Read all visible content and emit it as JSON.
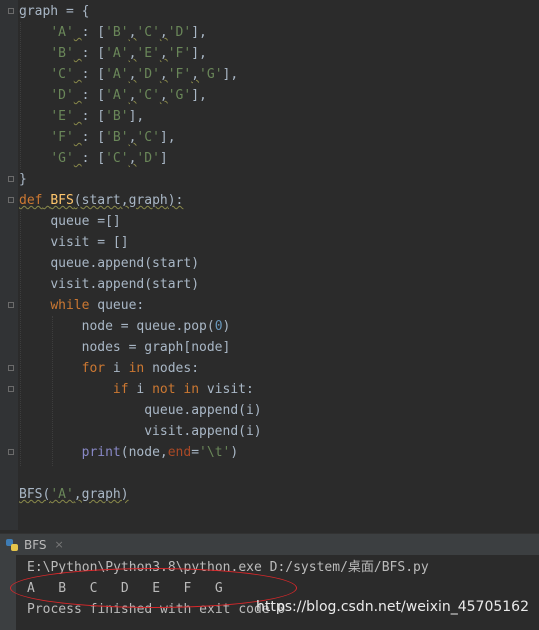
{
  "editor": {
    "line_1": "graph = {",
    "graph_lines": [
      {
        "key": "'A'",
        "items": [
          "'B'",
          "'C'",
          "'D'"
        ]
      },
      {
        "key": "'B'",
        "items": [
          "'A'",
          "'E'",
          "'F'"
        ]
      },
      {
        "key": "'C'",
        "items": [
          "'A'",
          "'D'",
          "'F'",
          "'G'"
        ]
      },
      {
        "key": "'D'",
        "items": [
          "'A'",
          "'C'",
          "'G'"
        ]
      },
      {
        "key": "'E'",
        "items": [
          "'B'"
        ]
      },
      {
        "key": "'F'",
        "items": [
          "'B'",
          "'C'"
        ]
      },
      {
        "key": "'G'",
        "items": [
          "'C'",
          "'D'"
        ]
      }
    ],
    "close_brace": "}",
    "def_kw": "def",
    "func_name": "BFS",
    "param_start": "start",
    "param_graph": "graph",
    "queue_init": "queue =[]",
    "visit_init": "visit = []",
    "queue_append": "queue.append(start)",
    "visit_append": "visit.append(start)",
    "while_kw": "while",
    "while_cond": " queue:",
    "node_pop_pre": "node = queue.pop(",
    "node_pop_num": "0",
    "node_pop_post": ")",
    "nodes_line": "nodes = graph[node]",
    "for_kw": "for",
    "for_var": " i ",
    "in_kw": "in",
    "for_iter": " nodes:",
    "if_kw": "if",
    "if_var": " i ",
    "not_kw": "not",
    "in_kw2": "in",
    "if_rest": " visit:",
    "qa_i": "queue.append(i)",
    "va_i": "visit.append(i)",
    "print_fn": "print",
    "print_args": "(node,",
    "end_kw": "end",
    "print_eq": "=",
    "print_str": "'\\t'",
    "print_close": ")",
    "call_fn": "BFS(",
    "call_arg": "'A'",
    "call_rest": ",graph)"
  },
  "run_panel": {
    "tab_label": "BFS",
    "close_glyph": "×"
  },
  "console": {
    "command": "E:\\Python\\Python3.8\\python.exe D:/system/桌面/BFS.py",
    "output": "A   B   C   D   E   F   G",
    "finished": "Process finished with exit code 0"
  },
  "watermark": "https://blog.csdn.net/weixin_45705162",
  "colors": {
    "background": "#2b2b2b",
    "keyword": "#cc7832",
    "string": "#6a8759",
    "function": "#ffc66d",
    "highlight_ellipse": "#d9282b"
  }
}
